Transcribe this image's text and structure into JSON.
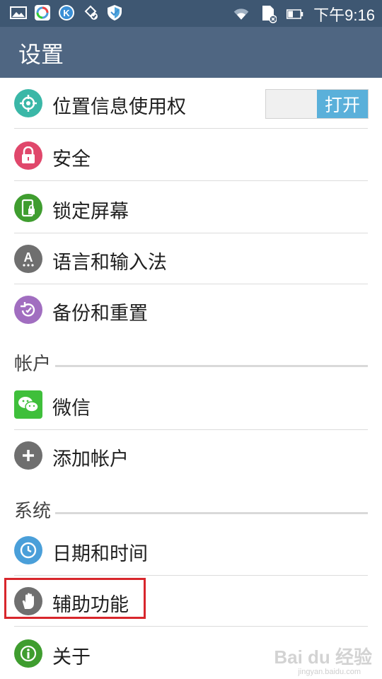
{
  "status_bar": {
    "time": "下午9:16",
    "icons_left": [
      "gallery-icon",
      "browser-icon",
      "k-app-icon",
      "cloud-check-icon",
      "shield-icon"
    ],
    "icons_right": [
      "wifi-icon",
      "sd-card-icon",
      "battery-icon"
    ]
  },
  "app_bar": {
    "title": "设置"
  },
  "items": [
    {
      "label": "位置信息使用权",
      "icon": "location-icon",
      "color": "#3ab7a7",
      "toggle": "打开"
    },
    {
      "label": "安全",
      "icon": "lock-icon",
      "color": "#e0476b"
    },
    {
      "label": "锁定屏幕",
      "icon": "phone-lock-icon",
      "color": "#3f9d2f"
    },
    {
      "label": "语言和输入法",
      "icon": "language-icon",
      "color": "#6f6f6f"
    },
    {
      "label": "备份和重置",
      "icon": "backup-icon",
      "color": "#a16ec0"
    }
  ],
  "sections": {
    "accounts": "帐户",
    "system": "系统"
  },
  "account_items": [
    {
      "label": "微信",
      "icon": "wechat-icon",
      "color": "#3fbf3b"
    },
    {
      "label": "添加帐户",
      "icon": "plus-icon",
      "color": "#6f6f6f"
    }
  ],
  "system_items": [
    {
      "label": "日期和时间",
      "icon": "clock-icon",
      "color": "#4a9fd9"
    },
    {
      "label": "辅助功能",
      "icon": "hand-icon",
      "color": "#6f6f6f"
    },
    {
      "label": "关于",
      "icon": "info-icon",
      "color": "#3f9d2f"
    }
  ],
  "watermark": {
    "text": "Bai du 经验",
    "sub": "jingyan.baidu.com"
  }
}
